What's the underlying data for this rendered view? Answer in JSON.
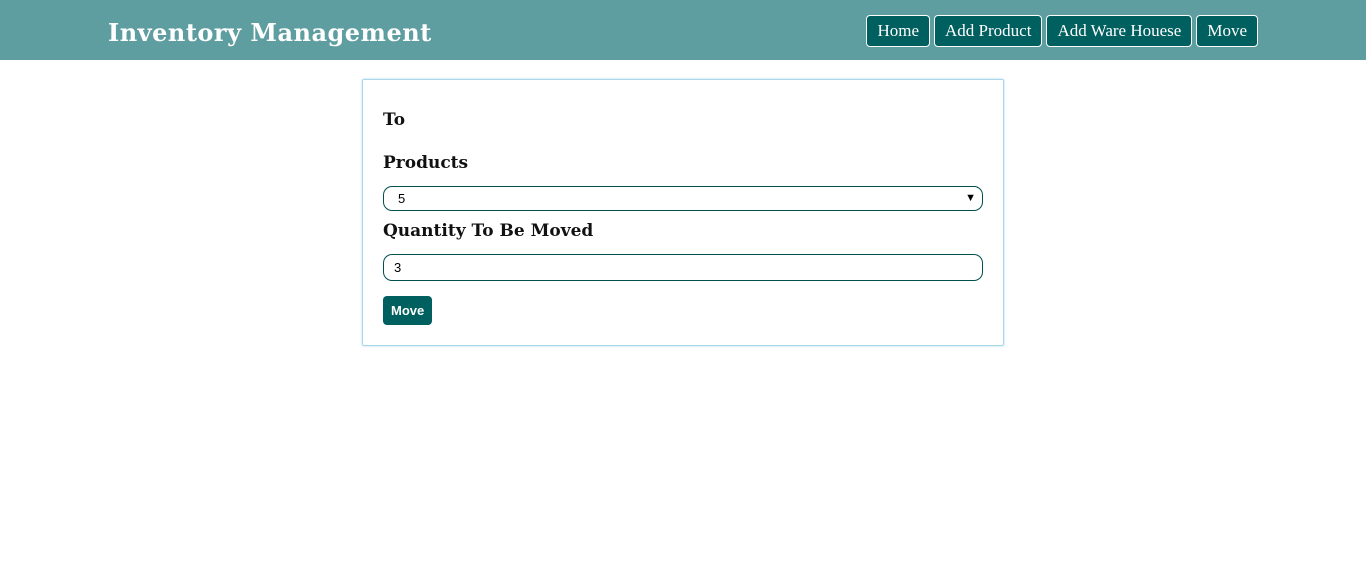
{
  "header": {
    "title": "Inventory Management",
    "nav": [
      {
        "label": "Home"
      },
      {
        "label": "Add Product"
      },
      {
        "label": "Add Ware Houese"
      },
      {
        "label": "Move"
      }
    ]
  },
  "form": {
    "to_label": "To",
    "products_label": "Products",
    "products_selected": "5",
    "quantity_label": "Quantity To Be Moved",
    "quantity_value": "3",
    "submit_label": "Move"
  },
  "colors": {
    "navbar": "#5f9ea0",
    "button": "#005f5f",
    "card_border": "#a9d8ea"
  },
  "icons": {
    "select_arrow": "dropdown-arrow-icon"
  }
}
